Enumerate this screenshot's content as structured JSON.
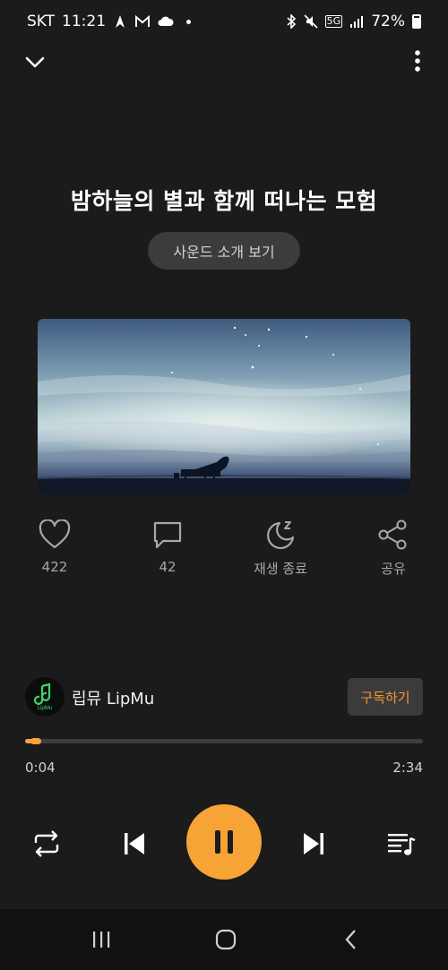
{
  "status_bar": {
    "carrier": "SKT",
    "time": "11:21",
    "network": "5G",
    "battery": "72%",
    "icons": [
      "rocket-icon",
      "gmail-icon",
      "cloud-icon",
      "bluetooth-icon",
      "mute-icon",
      "signal-icon",
      "battery-icon"
    ]
  },
  "header": {
    "collapse_icon": "chevron-down-icon",
    "menu_icon": "more-vertical-icon"
  },
  "track": {
    "title": "밤하늘의 별과 함께 떠나는 모험",
    "intro_button": "사운드 소개 보기"
  },
  "actions": {
    "like": {
      "icon": "heart-icon",
      "label": "422"
    },
    "comment": {
      "icon": "comment-icon",
      "label": "42"
    },
    "sleep": {
      "icon": "sleep-timer-icon",
      "label": "재생 종료"
    },
    "share": {
      "icon": "share-icon",
      "label": "공유"
    }
  },
  "channel": {
    "name": "립뮤 LipMu",
    "logo_text": "LipMu",
    "subscribe_label": "구독하기"
  },
  "progress": {
    "current": "0:04",
    "total": "2:34",
    "fraction": 0.026
  },
  "controls": {
    "repeat": "repeat-icon",
    "previous": "skip-previous-icon",
    "play_pause": "pause-icon",
    "next": "skip-next-icon",
    "playlist": "playlist-icon"
  },
  "colors": {
    "background": "#1b1b1b",
    "accent": "#f7a437",
    "subscribe_text": "#f39a2c"
  }
}
